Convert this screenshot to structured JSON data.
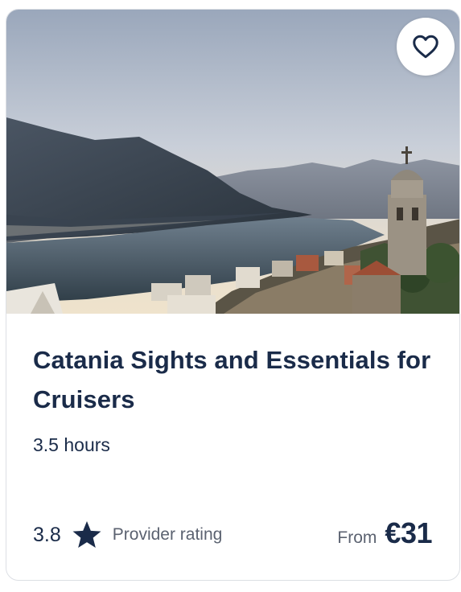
{
  "card": {
    "image_alt": "Kotor bay view",
    "favorite_icon": "heart-outline-icon",
    "title": "Catania Sights and Essentials for Cruisers",
    "duration": "3.5 hours",
    "rating": {
      "value": "3.8",
      "icon": "star-icon",
      "label": "Provider rating"
    },
    "price": {
      "prefix": "From",
      "value": "€31"
    }
  },
  "colors": {
    "text_primary": "#1a2b49",
    "text_secondary": "#5b6270",
    "border": "#dcdfe4"
  }
}
